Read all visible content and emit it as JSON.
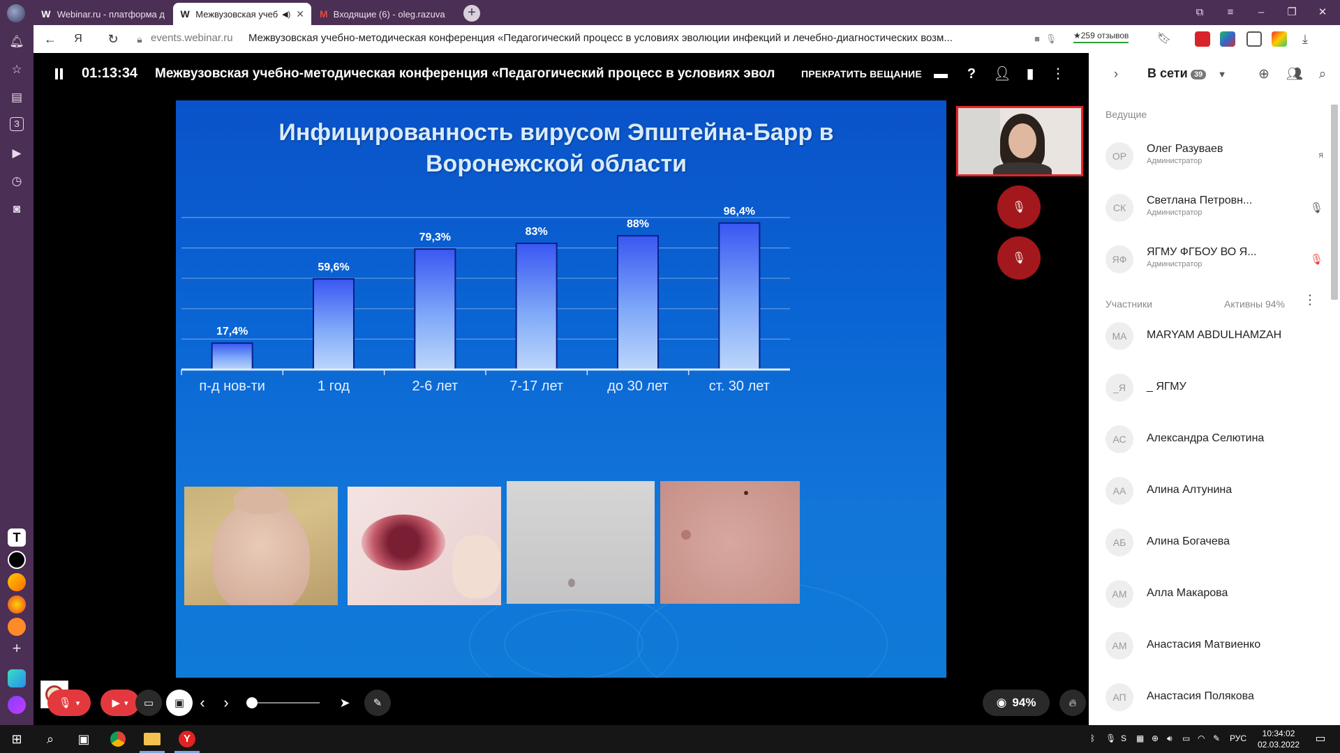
{
  "browser": {
    "tabs": [
      {
        "label": "Webinar.ru - платформа д",
        "favicon": "W"
      },
      {
        "label": "Межвузовская учеб",
        "favicon": "W"
      },
      {
        "label": "Входящие (6) - oleg.razuva",
        "favicon": "M"
      }
    ],
    "url_host": "events.webinar.ru",
    "page_title": "Межвузовская учебно-методическая конференция «Педагогический процесс в условиях эволюции инфекций и лечебно-диагностических возм...",
    "rating": "★259 отзывов"
  },
  "webinar": {
    "timer": "01:13:34",
    "title": "Межвузовская учебно-методическая конференция «Педагогический процесс в условиях эволюции инфекций и лечебно-диагностических возможностей»",
    "stop_label": "ПРЕКРАТИТЬ ВЕЩАНИЕ",
    "viewers_percent": "94%"
  },
  "slide": {
    "title_line1": "Инфицированность вирусом Эпштейна-Барр в",
    "title_line2": "Воронежской области"
  },
  "chart_data": {
    "type": "bar",
    "categories": [
      "п-д нов-ти",
      "1 год",
      "2-6 лет",
      "7-17 лет",
      "до 30 лет",
      "ст. 30 лет"
    ],
    "values": [
      17.4,
      59.6,
      79.3,
      83,
      88,
      96.4
    ],
    "data_labels": [
      "17,4%",
      "59,6%",
      "79,3%",
      "83%",
      "88%",
      "96,4%"
    ],
    "ylim": [
      0,
      100
    ],
    "grid": true
  },
  "panel": {
    "title": "В сети",
    "count": "39",
    "hosts_label": "Ведущие",
    "hosts": [
      {
        "initials": "ОР",
        "name": "Олег Разуваев",
        "role": "Администратор",
        "mark": "я"
      },
      {
        "initials": "СК",
        "name": "Светлана Петровн...",
        "role": "Администратор"
      },
      {
        "initials": "ЯФ",
        "name": "ЯГМУ ФГБОУ ВО Я...",
        "role": "Администратор"
      }
    ],
    "participants_label": "Участники",
    "active_label": "Активны 94%",
    "participants": [
      {
        "initials": "MA",
        "name": "MARYAM ABDULHAMZAH"
      },
      {
        "initials": "_Я",
        "name": "_ ЯГМУ"
      },
      {
        "initials": "АС",
        "name": "Александра Селютина"
      },
      {
        "initials": "АА",
        "name": "Алина Алтунина"
      },
      {
        "initials": "АБ",
        "name": "Алина Богачева"
      },
      {
        "initials": "АМ",
        "name": "Алла Макарова"
      },
      {
        "initials": "АМ",
        "name": "Анастасия Матвиенко"
      },
      {
        "initials": "АП",
        "name": "Анастасия Полякова"
      }
    ]
  },
  "taskbar": {
    "lang": "РУС",
    "time": "10:34:02",
    "date": "02.03.2022"
  },
  "colors": {
    "browser_frame": "#4c2f54",
    "slide_blue": "#0a5fd0",
    "mute_red": "#a3181c",
    "control_red": "#e3393e"
  }
}
